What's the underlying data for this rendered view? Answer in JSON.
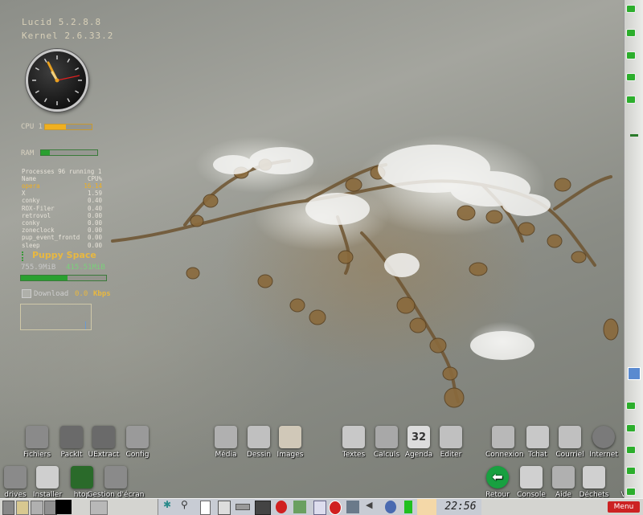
{
  "conky": {
    "distro": "Lucid  5.2.8.8",
    "kernel": "Kernel 2.6.33.2",
    "cpu_label": "CPU 1",
    "cpu_percent": 45,
    "ram_label": "RAM",
    "ram_percent": 15,
    "processes_line": "Processes  96 running  1",
    "proc_header_name": "Name",
    "proc_header_cpu": "CPU%",
    "processes": [
      {
        "name": "opera",
        "cpu": "16.14"
      },
      {
        "name": "X",
        "cpu": "1.59"
      },
      {
        "name": "conky",
        "cpu": "0.40"
      },
      {
        "name": "ROX-Filer",
        "cpu": "0.40"
      },
      {
        "name": "retrovol",
        "cpu": "0.00"
      },
      {
        "name": "conky",
        "cpu": "0.00"
      },
      {
        "name": "zoneclock",
        "cpu": "0.00"
      },
      {
        "name": "pup_event_frontd",
        "cpu": "0.00"
      },
      {
        "name": "sleep",
        "cpu": "0.00"
      }
    ],
    "puppy_space_title": "Puppy Space",
    "puppy_space_total": "755.9MiB",
    "puppy_space_free": "415.51MiB",
    "puppy_space_percent": 55,
    "download_label": "Download",
    "download_value": "0.0",
    "download_unit": "Kbps"
  },
  "desktop_icons": [
    {
      "label": "Fichiers",
      "icon": "folder-icon"
    },
    {
      "label": "PackIt",
      "icon": "zip-icon"
    },
    {
      "label": "UExtract",
      "icon": "zip-icon"
    },
    {
      "label": "Config",
      "icon": "gear-icon"
    },
    {
      "label": "Média",
      "icon": "media-icon"
    },
    {
      "label": "Dessin",
      "icon": "draw-icon"
    },
    {
      "label": "Images",
      "icon": "palette-icon"
    },
    {
      "label": "Textes",
      "icon": "text-icon"
    },
    {
      "label": "Calculs",
      "icon": "calculator-icon"
    },
    {
      "label": "Agenda",
      "icon": "calendar-icon"
    },
    {
      "label": "Editer",
      "icon": "edit-icon"
    },
    {
      "label": "Connexion",
      "icon": "network-icon"
    },
    {
      "label": "Tchat",
      "icon": "chat-icon"
    },
    {
      "label": "Courriel",
      "icon": "mail-icon"
    },
    {
      "label": "Internet",
      "icon": "globe-icon"
    },
    {
      "label": "drives",
      "icon": "drive-icon"
    },
    {
      "label": "Installer",
      "icon": "shield-icon"
    },
    {
      "label": "htop",
      "icon": "monitor-graph-icon"
    },
    {
      "label": "Gestion d'écran",
      "icon": "display-icon"
    },
    {
      "label": "Retour",
      "icon": "back-arrow-icon"
    },
    {
      "label": "Console",
      "icon": "console-icon"
    },
    {
      "label": "Aide",
      "icon": "help-icon"
    },
    {
      "label": "Déchets",
      "icon": "trash-icon"
    },
    {
      "label": "Ve",
      "icon": "truncated-icon"
    }
  ],
  "calendar_number": "32",
  "taskbar": {
    "clock": "22:56",
    "menu_label": "Menu"
  },
  "colors": {
    "conky_accent": "#f0b020",
    "conky_green": "#2aa030",
    "taskbar_bg": "#d4d4d0",
    "menu_button": "#cc2222"
  }
}
